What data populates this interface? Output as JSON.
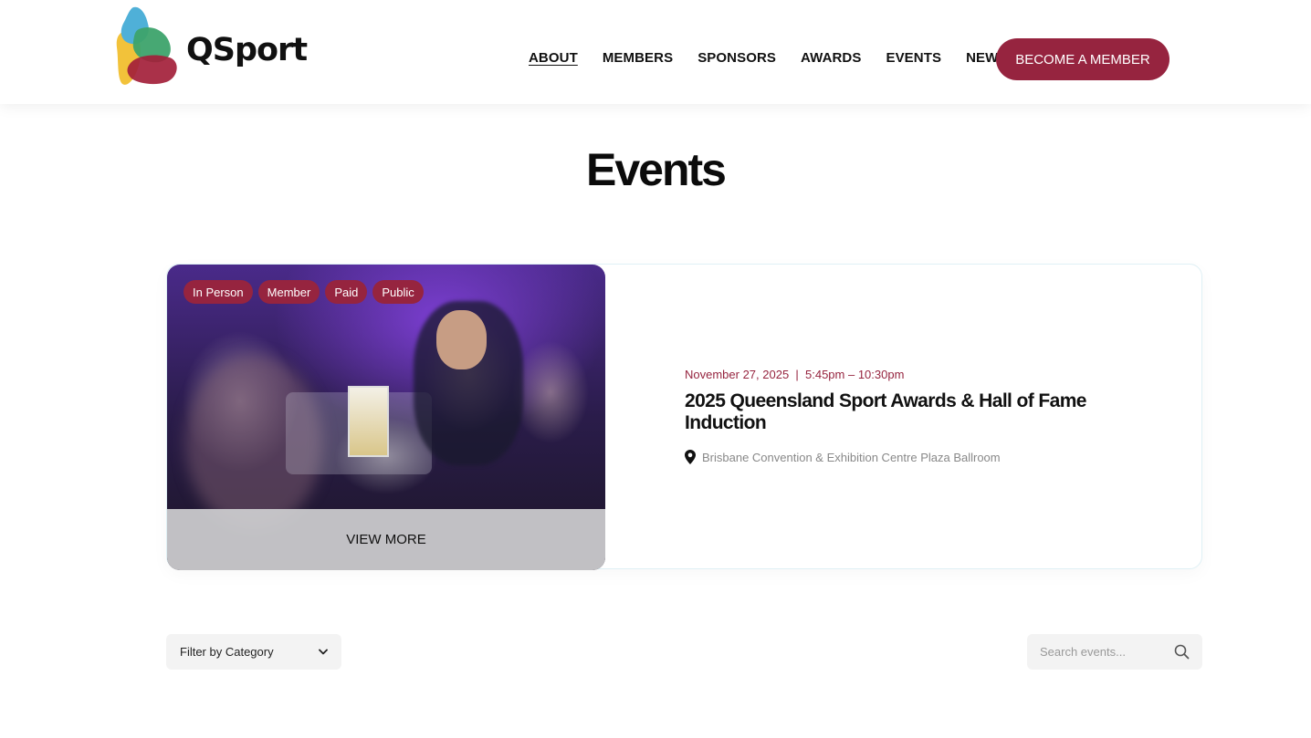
{
  "brand": {
    "name": "QSport"
  },
  "nav": {
    "items": [
      {
        "label": "ABOUT",
        "active": true
      },
      {
        "label": "MEMBERS"
      },
      {
        "label": "SPONSORS"
      },
      {
        "label": "AWARDS"
      },
      {
        "label": "EVENTS"
      },
      {
        "label": "NEWS"
      }
    ],
    "cta_label": "BECOME A MEMBER"
  },
  "page": {
    "title": "Events"
  },
  "featured_event": {
    "tags": [
      "In Person",
      "Member",
      "Paid",
      "Public"
    ],
    "view_more_label": "VIEW MORE",
    "date_time": "November 27, 2025  |  5:45pm – 10:30pm",
    "title": "2025 Queensland Sport Awards & Hall of Fame Induction",
    "location": "Brisbane Convention & Exhibition Centre Plaza Ballroom"
  },
  "filters": {
    "category_label": "Filter by Category",
    "search_placeholder": "Search events..."
  },
  "colors": {
    "accent": "#96243f",
    "text": "#111111",
    "muted": "#888888"
  },
  "icons": [
    "qsport-logo",
    "location-pin-icon",
    "chevron-down-icon",
    "search-icon"
  ]
}
